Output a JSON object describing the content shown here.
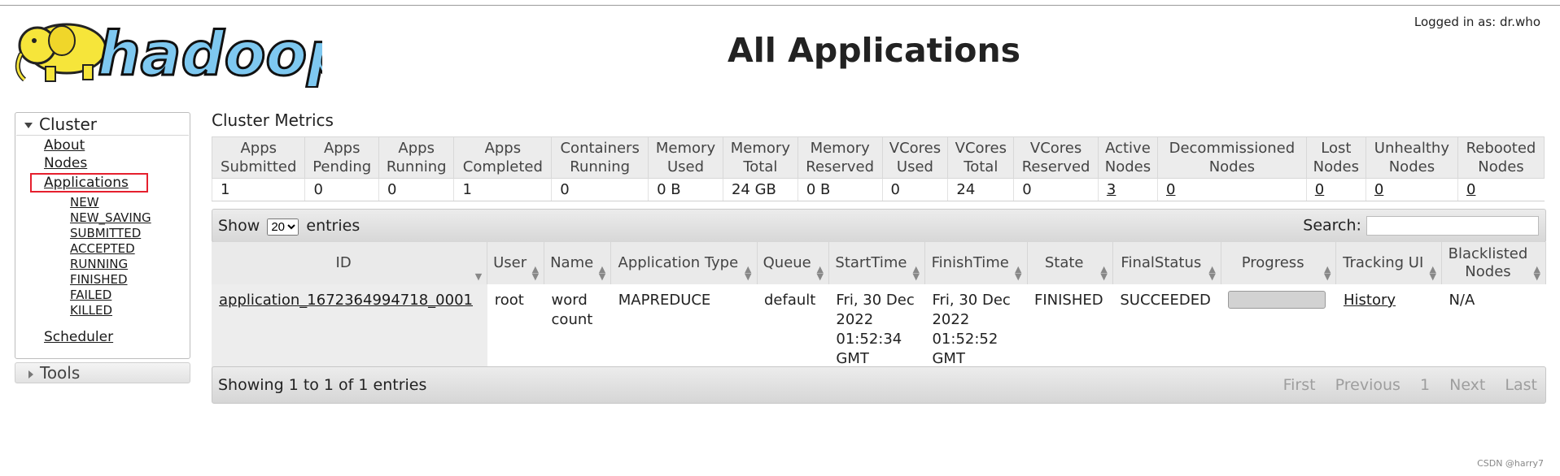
{
  "login_text": "Logged in as: dr.who",
  "logo_text": "hadoop",
  "page_title": "All Applications",
  "nav": {
    "cluster_label": "Cluster",
    "links": [
      "About",
      "Nodes",
      "Applications"
    ],
    "app_states": [
      "NEW",
      "NEW_SAVING",
      "SUBMITTED",
      "ACCEPTED",
      "RUNNING",
      "FINISHED",
      "FAILED",
      "KILLED"
    ],
    "scheduler": "Scheduler",
    "tools_label": "Tools"
  },
  "metrics": {
    "title": "Cluster Metrics",
    "headers": [
      [
        "Apps",
        "Submitted"
      ],
      [
        "Apps",
        "Pending"
      ],
      [
        "Apps",
        "Running"
      ],
      [
        "Apps",
        "Completed"
      ],
      [
        "Containers",
        "Running"
      ],
      [
        "Memory",
        "Used"
      ],
      [
        "Memory",
        "Total"
      ],
      [
        "Memory",
        "Reserved"
      ],
      [
        "VCores",
        "Used"
      ],
      [
        "VCores",
        "Total"
      ],
      [
        "VCores",
        "Reserved"
      ],
      [
        "Active",
        "Nodes"
      ],
      [
        "Decommissioned",
        "Nodes"
      ],
      [
        "Lost",
        "Nodes"
      ],
      [
        "Unhealthy",
        "Nodes"
      ],
      [
        "Rebooted",
        "Nodes"
      ]
    ],
    "values": [
      "1",
      "0",
      "0",
      "1",
      "0",
      "0 B",
      "24 GB",
      "0 B",
      "0",
      "24",
      "0",
      "3",
      "0",
      "0",
      "0",
      "0"
    ]
  },
  "toolbar": {
    "show_label": "Show",
    "entries_label": "entries",
    "page_size": "20",
    "search_label": "Search:"
  },
  "apps": {
    "headers": [
      [
        "ID"
      ],
      [
        "User"
      ],
      [
        "Name"
      ],
      [
        "Application Type"
      ],
      [
        "Queue"
      ],
      [
        "StartTime"
      ],
      [
        "FinishTime"
      ],
      [
        "State"
      ],
      [
        "FinalStatus"
      ],
      [
        "Progress"
      ],
      [
        "Tracking UI"
      ],
      [
        "Blacklisted",
        "Nodes"
      ]
    ],
    "rows": [
      {
        "id": "application_1672364994718_0001",
        "user": "root",
        "name": [
          "word",
          "count"
        ],
        "type": "MAPREDUCE",
        "queue": "default",
        "start": [
          "Fri, 30 Dec",
          "2022",
          "01:52:34",
          "GMT"
        ],
        "finish": [
          "Fri, 30 Dec",
          "2022",
          "01:52:52",
          "GMT"
        ],
        "state": "FINISHED",
        "final_status": "SUCCEEDED",
        "progress": 1,
        "tracking": "History",
        "blacklisted": "N/A"
      }
    ]
  },
  "footer": {
    "info": "Showing 1 to 1 of 1 entries",
    "pager": [
      "First",
      "Previous",
      "1",
      "Next",
      "Last"
    ]
  },
  "watermark": "CSDN @harry7",
  "colors": {
    "selected_outline": "#e5202e",
    "logo_yellow": "#f6e53a",
    "logo_blue": "#7ec8f0"
  }
}
